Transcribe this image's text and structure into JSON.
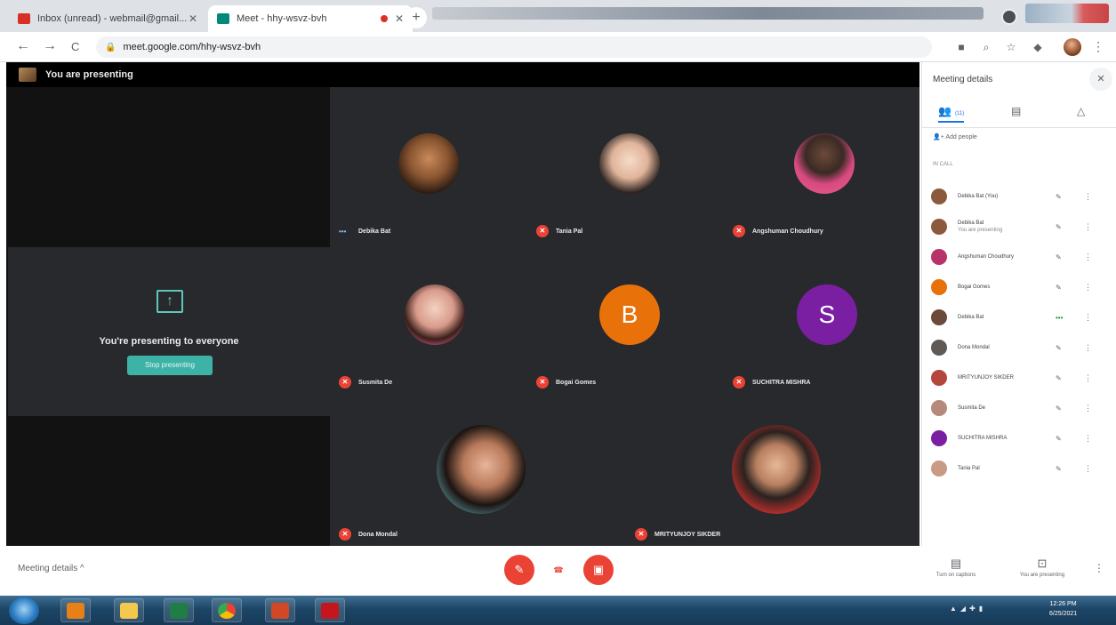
{
  "browser": {
    "tabs": [
      {
        "title": "Inbox (unread) - webmail@gmail...",
        "active": false
      },
      {
        "title": "Meet - hhy-wsvz-bvh",
        "active": true,
        "recording": true
      }
    ],
    "new_tab": "+",
    "url": "meet.google.com/hhy-wsvz-bvh",
    "nav": {
      "back": "←",
      "forward": "→",
      "reload": "C"
    }
  },
  "meet": {
    "banner": "You are presenting",
    "present": {
      "message": "You're presenting to everyone",
      "stop_label": "Stop presenting"
    },
    "participants": [
      {
        "name": "Debika Bat",
        "color": "#a87148",
        "muted": false,
        "kind": "photo"
      },
      {
        "name": "Tania Pal",
        "color": "#f2d4c2",
        "muted": true,
        "kind": "photo"
      },
      {
        "name": "Angshuman Choudhury",
        "color": "#d84a7f",
        "muted": true,
        "kind": "photo"
      },
      {
        "name": "Susmita De",
        "color": "#e8a9b0",
        "muted": true,
        "kind": "photo"
      },
      {
        "name": "Bogai Gomes",
        "letter": "B",
        "color": "#e8710a",
        "muted": true,
        "kind": "letter"
      },
      {
        "name": "SUCHITRA MISHRA",
        "letter": "S",
        "color": "#7b1fa2",
        "muted": true,
        "kind": "letter"
      },
      {
        "name": "Dona Mondal",
        "color": "#3a2a22",
        "muted": true,
        "kind": "photo"
      },
      {
        "name": "MRITYUNJOY SIKDER",
        "color": "#c9302c",
        "muted": true,
        "kind": "photo"
      }
    ],
    "bottom": {
      "details_label": "Meeting details",
      "chevron": "^",
      "captions_label": "Turn on captions",
      "presenting_label": "You are presenting"
    }
  },
  "side_panel": {
    "title": "Meeting details",
    "people_tab": {
      "label": "(11)",
      "sub": "Participants"
    },
    "add_people": "Add people",
    "section": "IN CALL",
    "people": [
      {
        "name": "Debika Bat (You)",
        "sub": "",
        "color": "#8b5a3c"
      },
      {
        "name": "Debika Bat",
        "sub": "You are presenting",
        "color": "#8b5a3c"
      },
      {
        "name": "Angshuman Choudhury",
        "sub": "",
        "color": "#b8336a"
      },
      {
        "name": "Bogai Gomes",
        "sub": "",
        "color": "#e8710a"
      },
      {
        "name": "Debika Bat",
        "sub": "",
        "color": "#6b4a3a"
      },
      {
        "name": "Dona Mondal",
        "sub": "",
        "color": "#5f5a56"
      },
      {
        "name": "MRITYUNJOY SIKDER",
        "sub": "",
        "color": "#b5463e"
      },
      {
        "name": "Susmita De",
        "sub": "",
        "color": "#b58a7a"
      },
      {
        "name": "SUCHITRA MISHRA",
        "sub": "",
        "color": "#7b1fa2"
      },
      {
        "name": "Tania Pal",
        "sub": "",
        "color": "#c99a84"
      }
    ]
  },
  "taskbar": {
    "time": "12:26 PM",
    "date": "6/25/2021"
  }
}
